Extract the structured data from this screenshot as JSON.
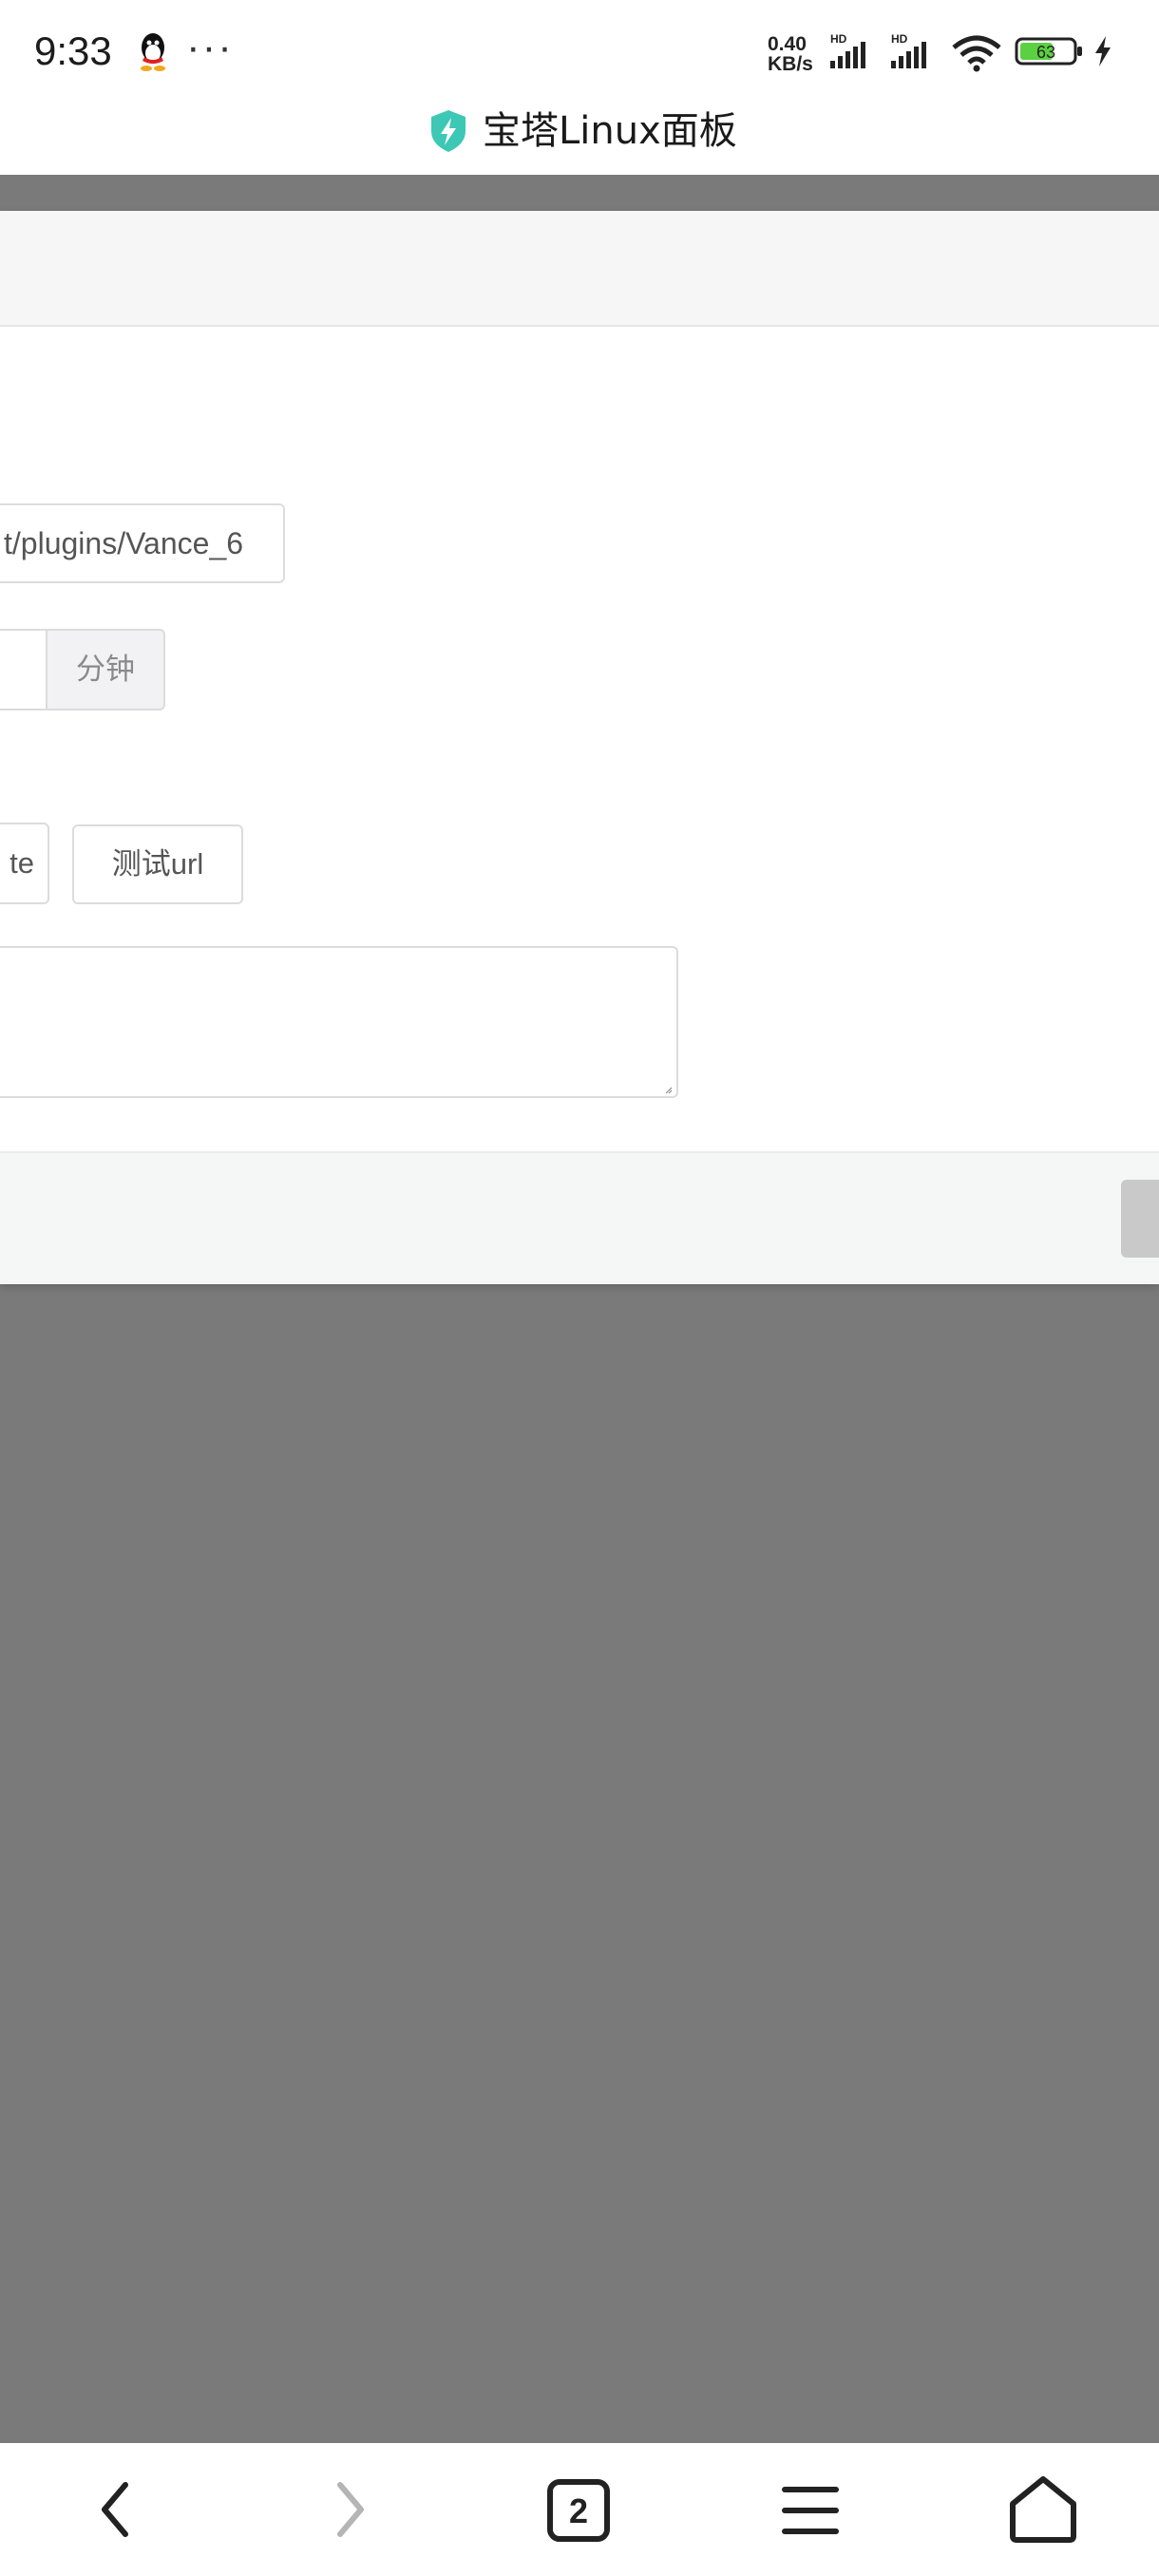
{
  "status_bar": {
    "time": "9:33",
    "more": "···",
    "net_speed_value": "0.40",
    "net_speed_unit": "KB/s",
    "signal_badge": "HD",
    "battery_level": "63",
    "icons": [
      "qq-icon",
      "signal-icon",
      "wifi-icon",
      "battery-icon",
      "charging-icon"
    ]
  },
  "browser": {
    "title": "宝塔Linux面板",
    "tab_count": "2"
  },
  "dialog": {
    "path_value": "t/plugins/Vance_6",
    "minutes_addon": "分钟",
    "url_value_fragment": "te",
    "test_url_label": "测试url",
    "textarea_value": ""
  },
  "colors": {
    "overlay": "#7a7a7a",
    "dialog_bg": "#ffffff",
    "header_bg": "#f6f6f6",
    "site_icon": "#3cc8b4",
    "battery_fill": "#5bd142"
  }
}
